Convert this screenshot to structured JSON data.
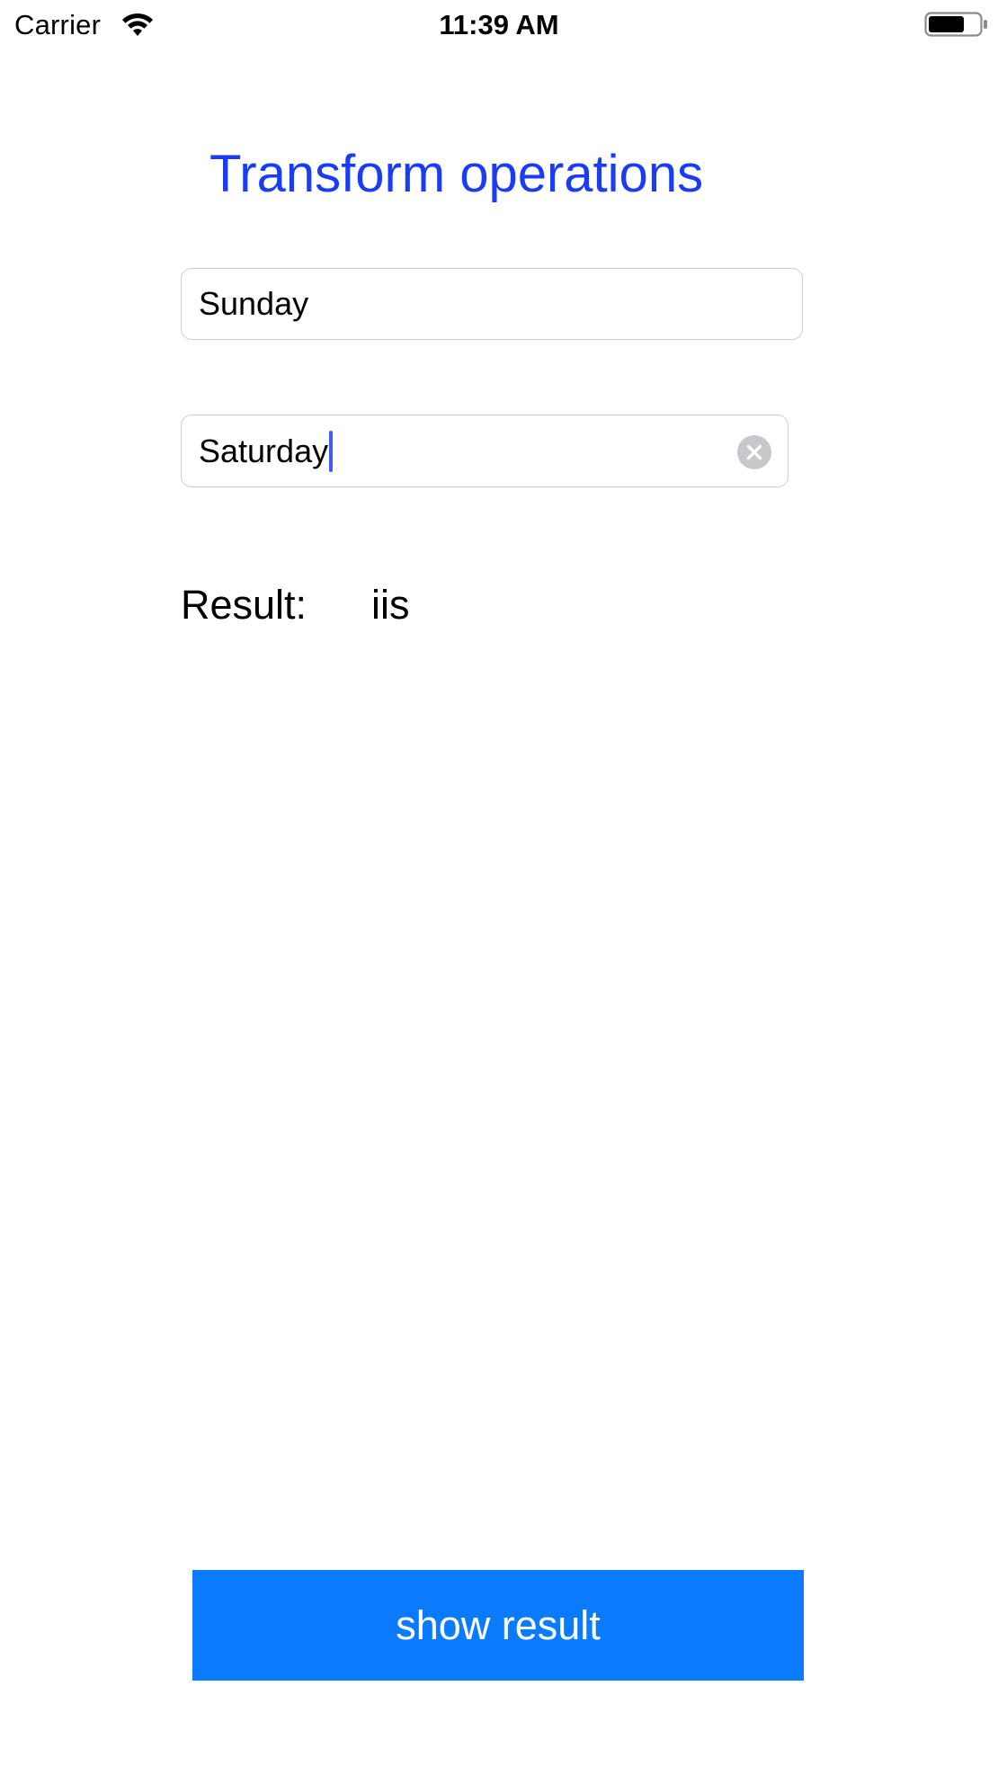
{
  "status_bar": {
    "carrier": "Carrier",
    "time": "11:39 AM",
    "wifi_icon": "wifi-icon",
    "battery_icon": "battery-icon"
  },
  "title": "Transform operations",
  "fields": {
    "first_value": "Sunday",
    "second_value": "Saturday",
    "clear_icon": "clear-circle-icon"
  },
  "result": {
    "label": "Result:",
    "value": "iis"
  },
  "button": {
    "label": "show result"
  },
  "colors": {
    "title": "#1a3cf2",
    "button_bg": "#0a7bff",
    "caret": "#3b5cf5"
  }
}
